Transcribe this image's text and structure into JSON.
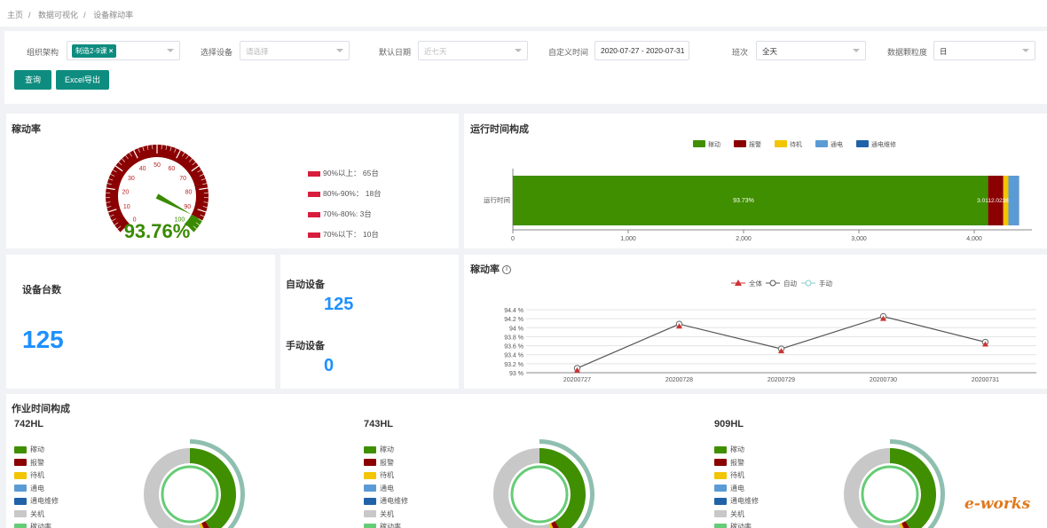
{
  "breadcrumb": [
    "主页",
    "数据可视化",
    "设备稼动率"
  ],
  "filters": {
    "org_label": "组织架构",
    "org_tag": "制造2-9课",
    "device_label": "选择设备",
    "device_ph": "请选择",
    "date_label": "默认日期",
    "date_ph": "近七天",
    "custom_label": "自定义时间",
    "custom_value": "2020-07-27 - 2020-07-31",
    "shift_label": "班次",
    "shift_value": "全天",
    "gran_label": "数据颗粒度",
    "gran_value": "日"
  },
  "buttons": {
    "query": "查询",
    "export": "Excel导出"
  },
  "utilization": {
    "title": "稼动率",
    "value": "93.76%",
    "gauge_ticks": [
      "0",
      "10",
      "20",
      "30",
      "40",
      "50",
      "60",
      "70",
      "80",
      "90",
      "100"
    ],
    "legend": [
      "90%以上： 65台",
      "80%-90%： 18台",
      "70%-80%: 3台",
      "70%以下： 10台"
    ],
    "colors": {
      "red": "#8b0000",
      "green": "#3a8a00"
    }
  },
  "runtime": {
    "title": "运行时间构成",
    "legend": [
      {
        "name": "稼动",
        "color": "#3f8f00"
      },
      {
        "name": "报警",
        "color": "#8b0000"
      },
      {
        "name": "待机",
        "color": "#f2c500"
      },
      {
        "name": "通电",
        "color": "#5b9bd5"
      },
      {
        "name": "通电维修",
        "color": "#2062a8"
      }
    ],
    "ylabel": "运行时间",
    "bar_label": "93.73%",
    "small_labels": "3.0112.0238",
    "xticks": [
      "0",
      "1,000",
      "2,000",
      "3,000",
      "4,000"
    ]
  },
  "devices": {
    "total_label": "设备台数",
    "total": "125",
    "auto_label": "自动设备",
    "auto": "125",
    "manual_label": "手动设备",
    "manual": "0"
  },
  "trend": {
    "title": "稼动率",
    "legend": [
      "全体",
      "自动",
      "手动"
    ],
    "yticks": [
      "94.4 %",
      "94.2 %",
      "94 %",
      "93.8 %",
      "93.6 %",
      "93.4 %",
      "93.2 %",
      "93 %"
    ],
    "dates": [
      "20200727",
      "20200728",
      "20200729",
      "20200730",
      "20200731"
    ]
  },
  "work": {
    "title": "作业时间构成",
    "machines": [
      "742HL",
      "743HL",
      "909HL"
    ],
    "legend": [
      "稼动",
      "报警",
      "待机",
      "通电",
      "通电维修",
      "关机",
      "稼动率"
    ],
    "legend_colors": [
      "#3f8f00",
      "#8b0000",
      "#f2c500",
      "#5b9bd5",
      "#2062a8",
      "#c8c8c8",
      "#66cc77"
    ]
  },
  "chart_data": [
    {
      "type": "bar",
      "title": "运行时间构成",
      "categories": [
        "运行时间"
      ],
      "xlim": [
        0,
        4500
      ],
      "series": [
        {
          "name": "稼动",
          "values": [
            4120
          ]
        },
        {
          "name": "报警",
          "values": [
            132
          ]
        },
        {
          "name": "待机",
          "values": [
            44
          ]
        },
        {
          "name": "通电",
          "values": [
            88
          ]
        },
        {
          "name": "通电维修",
          "values": [
            4
          ]
        }
      ]
    },
    {
      "type": "line",
      "title": "稼动率",
      "x": [
        "20200727",
        "20200728",
        "20200729",
        "20200730",
        "20200731"
      ],
      "ylim": [
        93,
        94.4
      ],
      "series": [
        {
          "name": "全体",
          "values": [
            93.1,
            94.08,
            93.53,
            94.25,
            93.68
          ]
        }
      ]
    }
  ],
  "footer_logo": "e-works"
}
